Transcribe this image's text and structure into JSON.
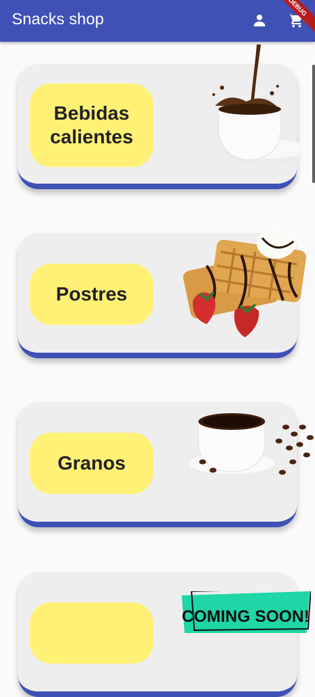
{
  "app": {
    "title": "Snacks shop",
    "debug_label": "DEBUG"
  },
  "toolbar": {
    "account_icon": "person-icon",
    "cart_icon": "shopping-cart-icon"
  },
  "categories": [
    {
      "label": "Bebidas calientes",
      "image": "coffee-pour-icon"
    },
    {
      "label": "Postres",
      "image": "waffle-dessert-icon"
    },
    {
      "label": "Granos",
      "image": "coffee-beans-cup-icon"
    },
    {
      "label": "",
      "image": "coming-soon-sign"
    }
  ],
  "coming_soon": "COMING SOON!",
  "colors": {
    "primary": "#3f51b5",
    "pill": "#fff176",
    "card": "#efeeee"
  }
}
